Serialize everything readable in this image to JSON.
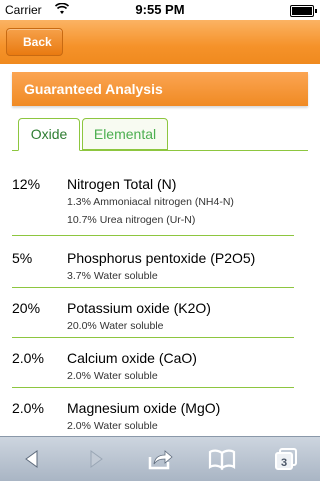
{
  "status_bar": {
    "carrier": "Carrier",
    "time": "9:55 PM"
  },
  "nav": {
    "back_label": "Back"
  },
  "section": {
    "title": "Guaranteed Analysis"
  },
  "tabs": [
    {
      "label": "Oxide",
      "active": true
    },
    {
      "label": "Elemental",
      "active": false
    }
  ],
  "rows": [
    {
      "percent": "12%",
      "name": "Nitrogen Total (N)",
      "details": [
        "1.3% Ammoniacal nitrogen (NH4-N)",
        "10.7% Urea nitrogen (Ur-N)"
      ]
    },
    {
      "percent": "5%",
      "name": "Phosphorus pentoxide (P2O5)",
      "details": [
        "3.7% Water soluble"
      ]
    },
    {
      "percent": "20%",
      "name": "Potassium oxide (K2O)",
      "details": [
        "20.0% Water soluble"
      ]
    },
    {
      "percent": "2.0%",
      "name": "Calcium oxide (CaO)",
      "details": [
        "2.0% Water soluble"
      ]
    },
    {
      "percent": "2.0%",
      "name": "Magnesium oxide (MgO)",
      "details": [
        "2.0% Water soluble"
      ]
    }
  ],
  "toolbar": {
    "items": [
      {
        "icon": "back-arrow-icon"
      },
      {
        "icon": "forward-arrow-icon"
      },
      {
        "icon": "share-icon"
      },
      {
        "icon": "bookmarks-icon"
      },
      {
        "icon": "tabs-icon",
        "count": "3"
      }
    ]
  },
  "colors": {
    "accent_orange": "#f5922a",
    "tab_green": "#8dc63f"
  }
}
